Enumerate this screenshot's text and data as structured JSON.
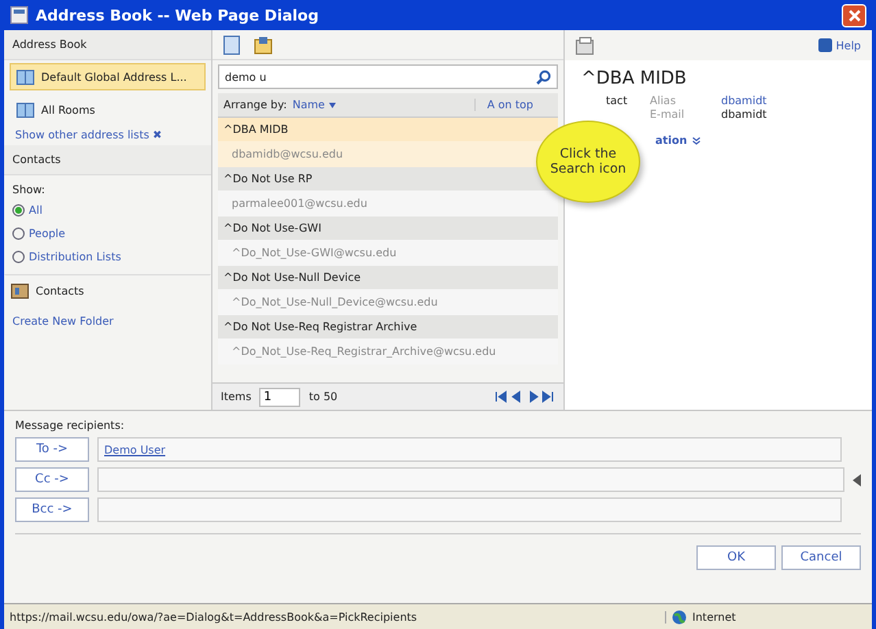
{
  "window": {
    "title": "Address Book -- Web Page Dialog"
  },
  "left": {
    "header": "Address Book",
    "lists": [
      {
        "label": "Default Global Address L...",
        "selected": true
      },
      {
        "label": "All Rooms",
        "selected": false
      }
    ],
    "show_other": "Show other address lists ✖",
    "contacts_header": "Contacts",
    "show_label": "Show:",
    "filters": [
      {
        "label": "All",
        "selected": true
      },
      {
        "label": "People",
        "selected": false
      },
      {
        "label": "Distribution Lists",
        "selected": false
      }
    ],
    "folder": "Contacts",
    "create_folder": "Create New Folder"
  },
  "search": {
    "value": "demo u"
  },
  "arrange": {
    "label": "Arrange by:",
    "field": "Name",
    "order": "A on top"
  },
  "results": [
    {
      "name": "^DBA MIDB",
      "email": "dbamidb@wcsu.edu",
      "selected": true
    },
    {
      "name": "^Do Not Use RP",
      "email": "parmalee001@wcsu.edu",
      "selected": false
    },
    {
      "name": "^Do Not Use-GWI",
      "email": "^Do_Not_Use-GWI@wcsu.edu",
      "selected": false
    },
    {
      "name": "^Do Not Use-Null Device",
      "email": "^Do_Not_Use-Null_Device@wcsu.edu",
      "selected": false
    },
    {
      "name": "^Do Not Use-Req Registrar Archive",
      "email": "^Do_Not_Use-Req_Registrar_Archive@wcsu.edu",
      "selected": false
    }
  ],
  "paging": {
    "label": "Items",
    "value": "1",
    "range": "to 50"
  },
  "detail": {
    "help": "Help",
    "name": "^DBA MIDB",
    "section": "tact",
    "fields": [
      {
        "label": "Alias",
        "value": "dbamidt",
        "kind": "link"
      },
      {
        "label": "E-mail",
        "value": "dbamidt",
        "kind": "text"
      }
    ],
    "more": "ation"
  },
  "callout": "Click the Search icon",
  "recipients": {
    "title": "Message recipients:",
    "rows": [
      {
        "button": "To ->",
        "value": "Demo User"
      },
      {
        "button": "Cc ->"
      },
      {
        "button": "Bcc ->"
      }
    ]
  },
  "buttons": [
    "OK",
    "Cancel"
  ],
  "status_bar": {
    "url": "https://mail.wcsu.edu/owa/?ae=Dialog&t=AddressBook&a=PickRecipients",
    "zone": "Internet"
  }
}
